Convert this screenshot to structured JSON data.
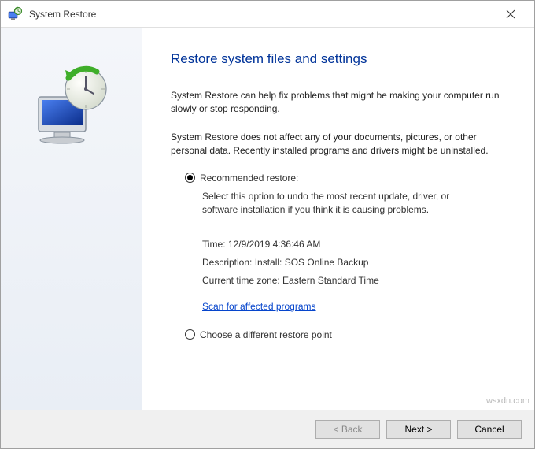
{
  "window": {
    "title": "System Restore"
  },
  "heading": "Restore system files and settings",
  "para1": "System Restore can help fix problems that might be making your computer run slowly or stop responding.",
  "para2": "System Restore does not affect any of your documents, pictures, or other personal data. Recently installed programs and drivers might be uninstalled.",
  "options": {
    "recommended": {
      "label": "Recommended restore:",
      "desc": "Select this option to undo the most recent update, driver, or software installation if you think it is causing problems.",
      "time": "Time: 12/9/2019 4:36:46 AM",
      "description": "Description: Install: SOS Online Backup",
      "timezone": "Current time zone: Eastern Standard Time",
      "scan_link": "Scan for affected programs"
    },
    "different": {
      "label": "Choose a different restore point"
    }
  },
  "buttons": {
    "back": "< Back",
    "next": "Next >",
    "cancel": "Cancel"
  },
  "watermark": "wsxdn.com"
}
